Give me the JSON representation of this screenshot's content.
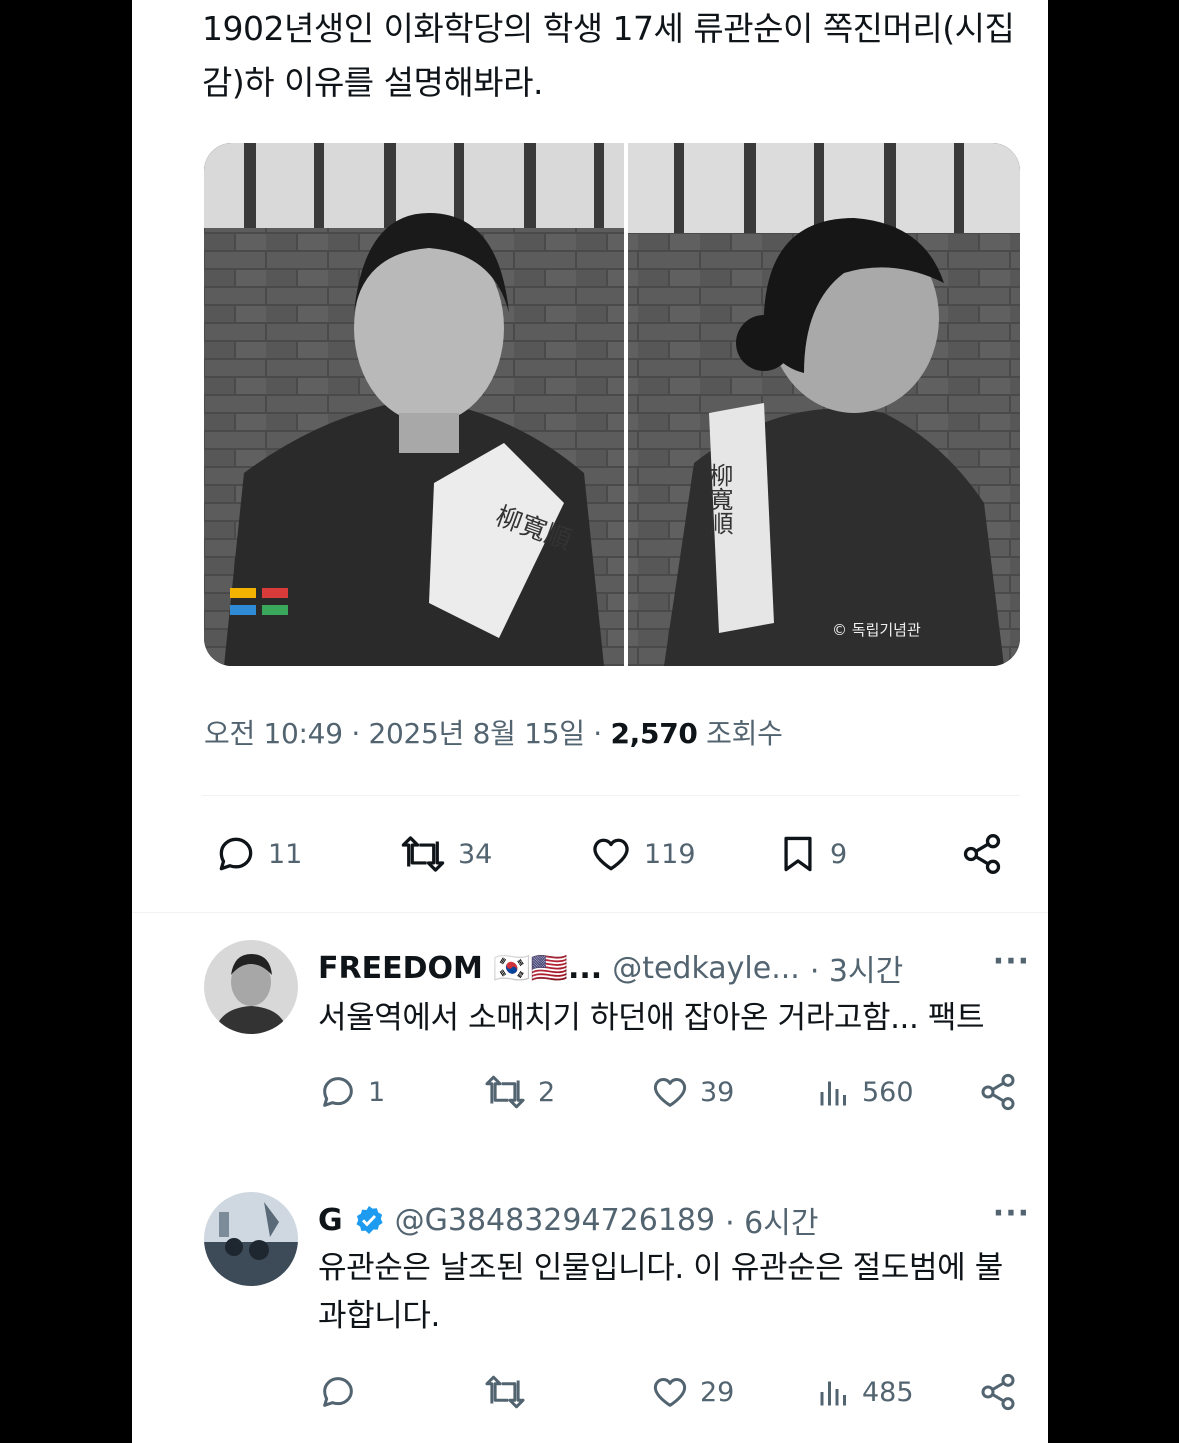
{
  "post": {
    "text": "1902년생인 이화학당의 학생 17세 류관순이 쪽진머리(시집감)하 이유를 설명해봐라.",
    "image": {
      "sign_left": "柳寬順",
      "sign_right": "柳寬順",
      "watermark": "© 독립기념관"
    },
    "meta_time": "오전 10:49 · 2025년 8월 15일 · ",
    "meta_views": "2,570",
    "meta_views_label": " 조회수",
    "actions": {
      "replies": "11",
      "reposts": "34",
      "likes": "119",
      "bookmarks": "9"
    }
  },
  "replies": [
    {
      "name": "FREEDOM 🇰🇷🇺🇸...",
      "handle": "@tedkayle...",
      "time": "· 3시간",
      "text": "서울역에서 소매치기 하던애 잡아온 거라고함... 팩트",
      "actions": {
        "replies": "1",
        "reposts": "2",
        "likes": "39",
        "views": "560"
      }
    },
    {
      "name": "G",
      "handle": "@G38483294726189",
      "time": "· 6시간",
      "text": "유관순은 날조된 인물입니다. 이 유관순은 절도범에 불과합니다.",
      "actions": {
        "replies": "",
        "reposts": "",
        "likes": "29",
        "views": "485"
      }
    }
  ],
  "colors": {
    "text": "#0f1419",
    "muted": "#536471",
    "verified": "#1d9bf0",
    "border": "#eff3f4"
  }
}
